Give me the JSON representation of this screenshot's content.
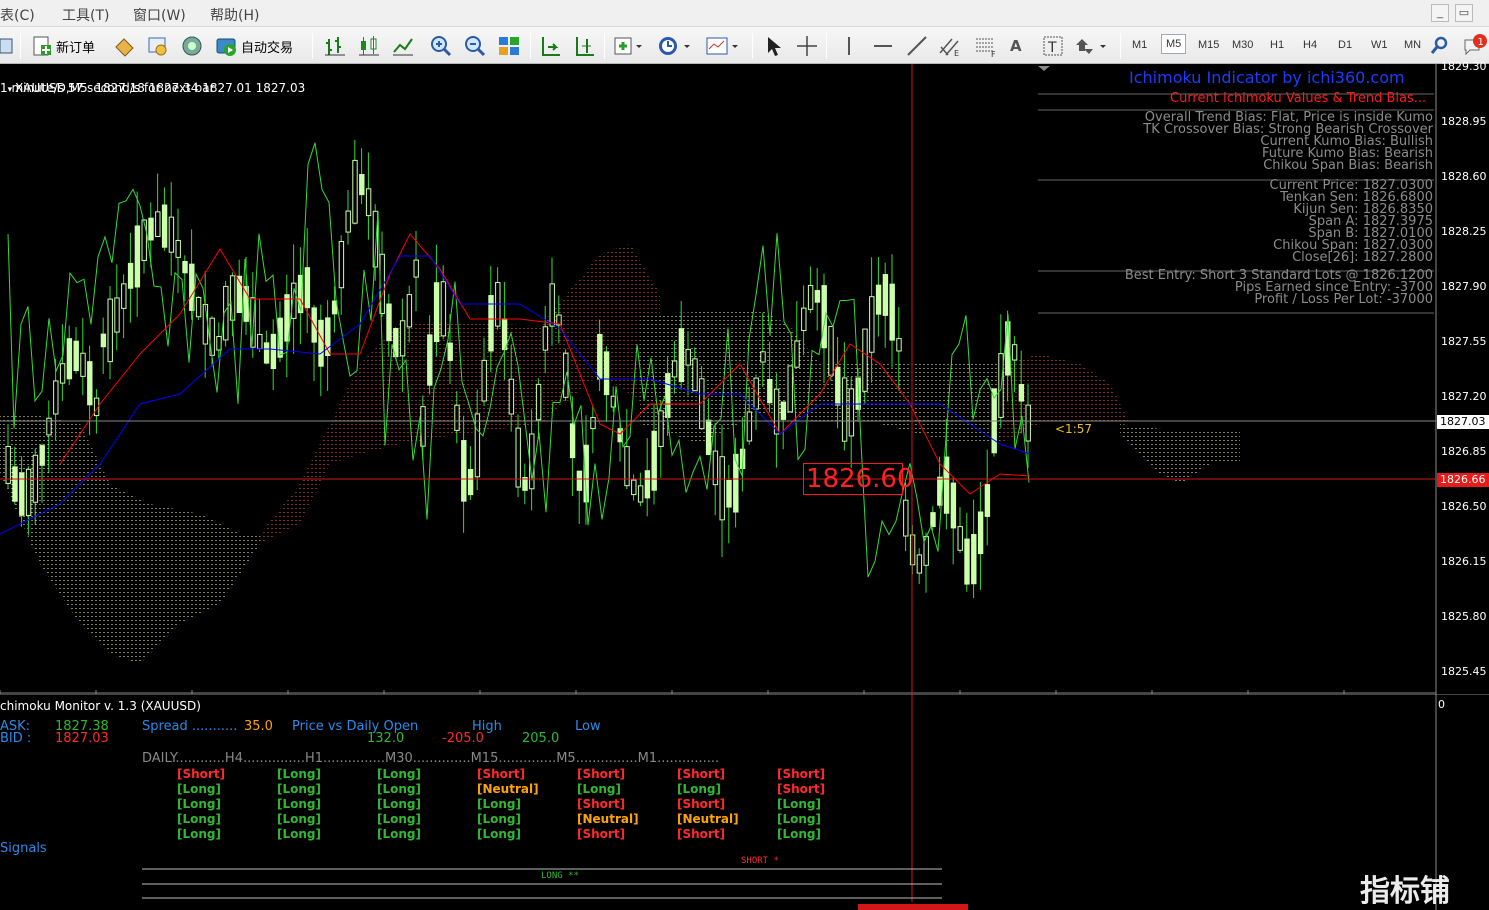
{
  "menu": {
    "items": [
      "表(C)",
      "工具(T)",
      "窗口(W)",
      "帮助(H)"
    ]
  },
  "window_controls": {
    "minimize": "_",
    "restore": "▭"
  },
  "toolbar": {
    "new_order": "新订单",
    "auto_trade": "自动交易",
    "timeframes": [
      "M1",
      "M5",
      "M15",
      "M30",
      "H1",
      "H4",
      "D1",
      "W1",
      "MN"
    ],
    "active_timeframe": "M5",
    "notification_count": "1",
    "text_tool": "A"
  },
  "chart_header": {
    "symbol_line": "XAUUSD,M5  1827.18 1827.34 1827.01 1827.03",
    "timer": "1 minute/s 57 second/s for next bar"
  },
  "ichimoku_panel": {
    "title": "Ichimoku Indicator by ichi360.com",
    "subtitle": "Current Ichimoku Values & Trend Bias...",
    "bias_lines": [
      "Overall Trend Bias: Flat, Price is inside Kumo",
      "TK Crossover Bias: Strong Bearish Crossover",
      "Current Kumo Bias: Bullish",
      "Future Kumo Bias: Bearish",
      "Chikou Span Bias: Bearish"
    ],
    "value_lines": [
      "Current Price: 1827.0300",
      "Tenkan Sen: 1826.6800",
      "Kijun Sen: 1826.8350",
      "Span A: 1827.3975",
      "Span B: 1827.0100",
      "Chikou Span: 1827.0300",
      "Close[26]: 1827.2800"
    ],
    "entry_lines": [
      "Best Entry: Short 3 Standard Lots @ 1826.1200",
      "Pips Earned since Entry: -3700",
      "Profit / Loss Per Lot: -37000"
    ]
  },
  "price_axis": {
    "ticks": [
      "1829.30",
      "1828.95",
      "1828.60",
      "1828.25",
      "1827.90",
      "1827.55",
      "1827.20",
      "1826.85",
      "1826.50",
      "1826.15",
      "1825.80",
      "1825.45"
    ],
    "current_price": "1827.03",
    "line_price": "1826.66",
    "sub_zero": "0"
  },
  "chart_labels": {
    "crosshair_price": "1826.60",
    "countdown": "<1:57"
  },
  "monitor": {
    "title": "chimoku Monitor v. 1.3 (XAUUSD)",
    "ask_label": "ASK:",
    "ask_value": "1827.38",
    "bid_label": "BID :",
    "bid_value": "1827.03",
    "spread_label": "Spread ...........",
    "spread_value": "35.0",
    "pvdo_label": "Price vs Daily Open",
    "pvdo_value": "132.0",
    "high_label": "High",
    "high_value": "-205.0",
    "low_label": "Low",
    "low_value": "205.0",
    "tf_header": "DAILY............H4...............H1...............M30..............M15..............M5...............M1...............",
    "signals_label": "Signals",
    "short_marker": "SHORT *",
    "long_marker": "LONG **",
    "grid": [
      [
        "[Short]",
        "[Long]",
        "[Long]",
        "[Long]",
        "[Long]"
      ],
      [
        "[Long]",
        "[Long]",
        "[Long]",
        "[Long]",
        "[Long]"
      ],
      [
        "[Long]",
        "[Long]",
        "[Long]",
        "[Long]",
        "[Long]"
      ],
      [
        "[Short]",
        "[Neutral]",
        "[Long]",
        "[Long]",
        "[Long]"
      ],
      [
        "[Short]",
        "[Long]",
        "[Short]",
        "[Neutral]",
        "[Short]"
      ],
      [
        "[Short]",
        "[Long]",
        "[Short]",
        "[Neutral]",
        "[Short]"
      ],
      [
        "[Short]",
        "[Short]",
        "[Long]",
        "[Long]",
        "[Long]"
      ]
    ]
  },
  "watermark": "指标铺",
  "colors": {
    "short": "#ff2a2a",
    "long": "#2fb92f",
    "neutral": "#ffa500",
    "candle": "#ccffaa",
    "tenkan": "#ff0000",
    "kijun": "#0000ff",
    "chikou": "#33dd33",
    "kumo_bull": "#ffff99",
    "kumo_bear": "#ff6633"
  }
}
